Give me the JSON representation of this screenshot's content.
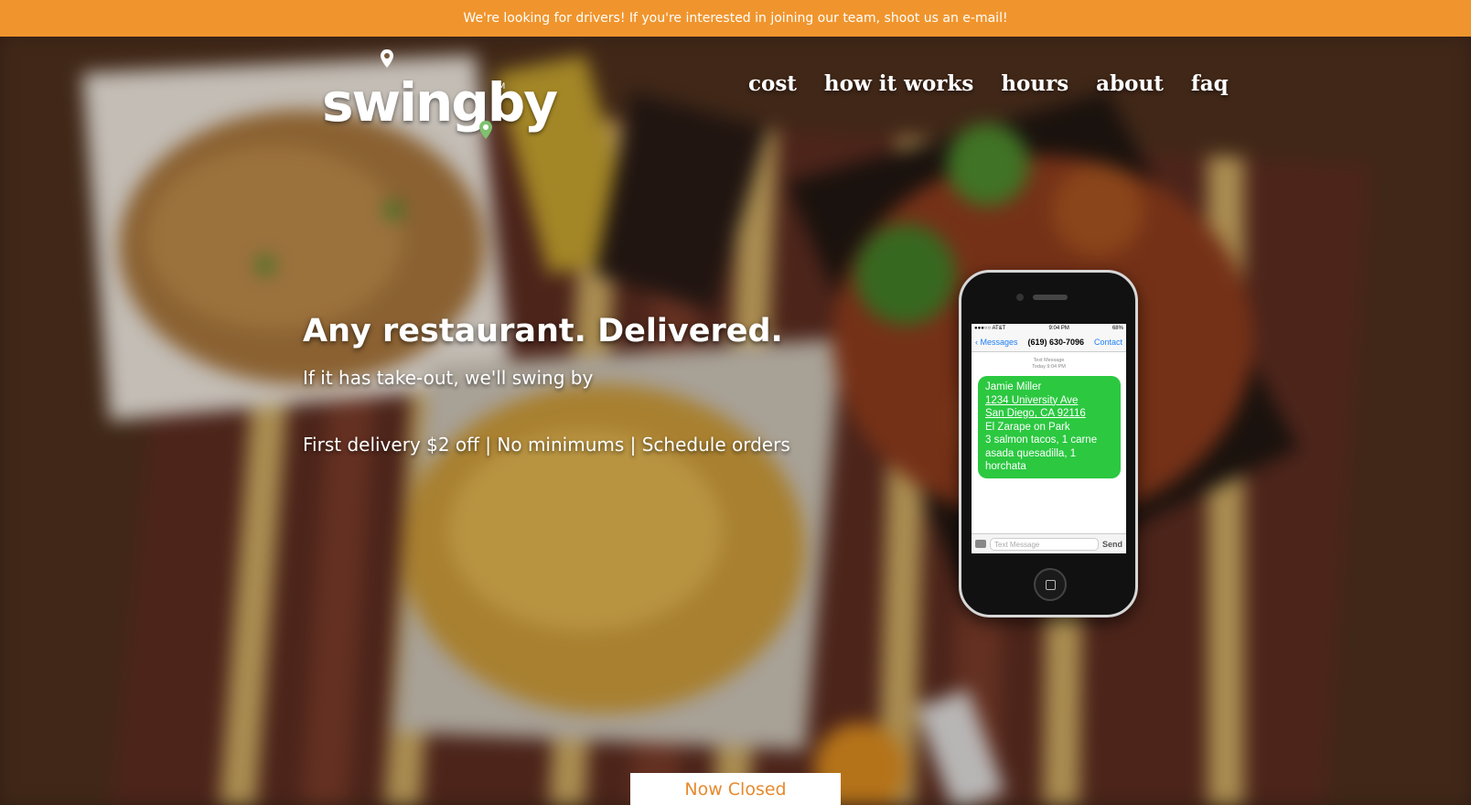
{
  "banner": {
    "text": "We're looking for drivers! If you're interested in joining our team, shoot us an e-mail!"
  },
  "logo": {
    "text": "swingby",
    "trademark": "TM",
    "pin_color": "#7fc16e"
  },
  "nav": {
    "items": [
      {
        "label": "cost"
      },
      {
        "label": "how it works"
      },
      {
        "label": "hours"
      },
      {
        "label": "about"
      },
      {
        "label": "faq"
      }
    ]
  },
  "hero": {
    "headline": "Any restaurant. Delivered.",
    "subhead": "If it has take-out, we'll swing by",
    "features": "First delivery $2 off | No minimums | Schedule orders"
  },
  "phone": {
    "status": {
      "carrier": "●●●○○ AT&T",
      "time": "9:04 PM",
      "battery": "68%"
    },
    "header": {
      "back": "Messages",
      "number": "(619) 630-7096",
      "contact": "Contact"
    },
    "meta": {
      "label": "Text Message",
      "timestamp": "Today 9:04 PM"
    },
    "message": {
      "name": "Jamie Miller",
      "address_line1": "1234 University Ave",
      "address_line2": "San Diego, CA 92116",
      "restaurant": "El Zarape on Park",
      "order": "3 salmon tacos, 1 carne asada quesadilla, 1 horchata"
    },
    "compose": {
      "placeholder": "Text Message",
      "send": "Send"
    }
  },
  "status_button": {
    "label": "Now Closed"
  },
  "colors": {
    "banner": "#f0952d",
    "accent_text": "#e68a2e",
    "bubble": "#2bc840"
  }
}
